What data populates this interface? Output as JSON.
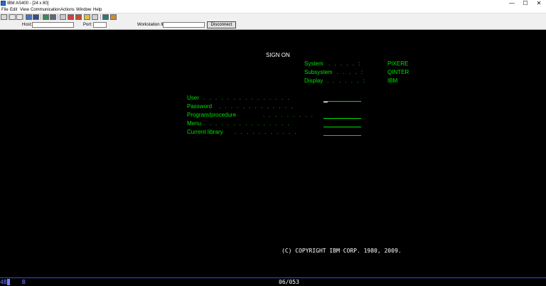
{
  "window": {
    "title": "IBM AS400 - [24 x 80]",
    "controls": [
      "—",
      "☐",
      "✕"
    ]
  },
  "menu": [
    "File",
    "Edit",
    "View",
    "Communication",
    "Actions",
    "Window",
    "Help"
  ],
  "connection": {
    "host_label": "Host:",
    "host_value": "",
    "port_label": "Port:",
    "port_value": "",
    "workstation_label": "Workstation ID:",
    "workstation_value": "",
    "disconnect_label": "Disconnect"
  },
  "signon": {
    "title": "SIGN ON",
    "system_info": [
      {
        "label": "System",
        "dots": ". . . . . :",
        "value": "PIXERE"
      },
      {
        "label": "Subsystem",
        "dots": ". . . . :",
        "value": "QINTER"
      },
      {
        "label": "Display",
        "dots": ". . . . . . :",
        "value": "IBM"
      }
    ],
    "fields": [
      {
        "label": "User",
        "dots": ". . . . . . . . . . . . . . ."
      },
      {
        "label": "Password",
        "dots": ". . . . . . . . . . . . ."
      },
      {
        "label": "Program/procedure",
        "dots": ". . . . . . . . ."
      },
      {
        "label": "Menu",
        "dots": ". . . . . . . . . . . . . . ."
      },
      {
        "label": "Current library",
        "dots": ". . . . . . . . . . ."
      }
    ],
    "copyright": "(C) COPYRIGHT IBM CORP. 1980, 2009."
  },
  "status": {
    "left": "4B",
    "indicator": "B",
    "position": "06/053"
  },
  "colors": {
    "terminal_bg": "#000000",
    "text_green": "#00e000",
    "text_white": "#ffffff",
    "status_blue": "#6f7fff"
  }
}
